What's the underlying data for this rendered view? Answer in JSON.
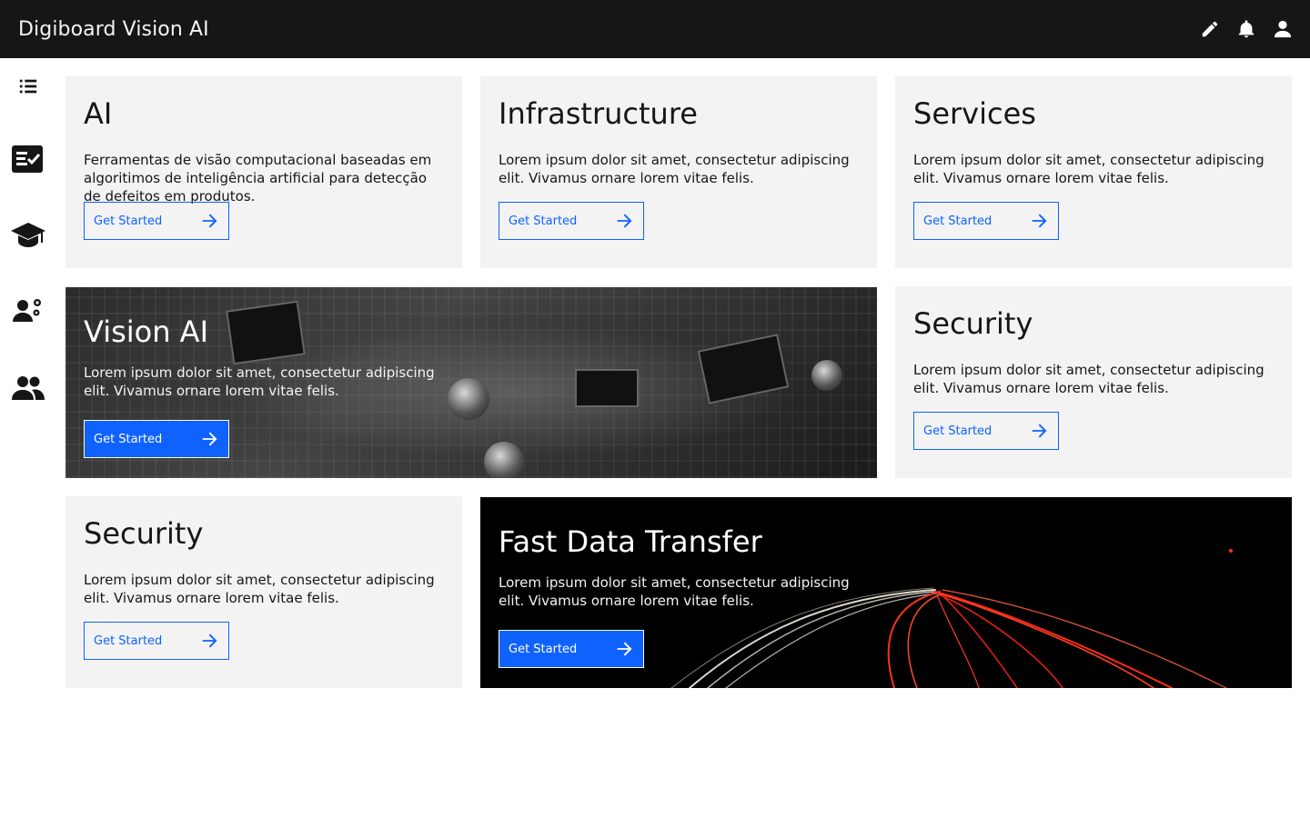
{
  "app": {
    "title": "Digiboard Vision AI"
  },
  "topbar": {
    "actions": [
      {
        "icon": "edit-icon"
      },
      {
        "icon": "bell-icon"
      },
      {
        "icon": "user-icon"
      }
    ]
  },
  "sidebar": {
    "items": [
      {
        "icon": "list-icon"
      },
      {
        "icon": "checklist-icon"
      },
      {
        "icon": "graduation-cap-icon"
      },
      {
        "icon": "user-settings-icon"
      },
      {
        "icon": "users-icon"
      }
    ]
  },
  "cards": {
    "ai": {
      "title": "AI",
      "text": "Ferramentas de visão computacional baseadas em algoritimos de inteligência artificial para detecção de defeitos em produtos.",
      "button": "Get Started"
    },
    "infrastructure": {
      "title": "Infrastructure",
      "text": "Lorem ipsum dolor sit amet, consectetur adipiscing elit. Vivamus ornare lorem vitae felis.",
      "button": "Get Started"
    },
    "services": {
      "title": "Services",
      "text": "Lorem ipsum dolor sit amet, consectetur adipiscing elit. Vivamus ornare lorem vitae felis.",
      "button": "Get Started"
    },
    "vision_ai": {
      "title": "Vision AI",
      "text": "Lorem ipsum dolor sit amet, consectetur adipiscing elit. Vivamus ornare lorem vitae felis.",
      "button": "Get Started"
    },
    "security_right": {
      "title": "Security",
      "text": "Lorem ipsum dolor sit amet, consectetur adipiscing elit. Vivamus ornare lorem vitae felis.",
      "button": "Get Started"
    },
    "security_left": {
      "title": "Security",
      "text": "Lorem ipsum dolor sit amet, consectetur adipiscing elit. Vivamus ornare lorem vitae felis.",
      "button": "Get Started"
    },
    "fast_data": {
      "title": "Fast Data Transfer",
      "text": "Lorem ipsum dolor sit amet, consectetur adipiscing elit. Vivamus ornare lorem vitae felis.",
      "button": "Get Started"
    }
  },
  "colors": {
    "topbar": "#161616",
    "card": "#f3f3f3",
    "accent": "#0f62fe"
  }
}
